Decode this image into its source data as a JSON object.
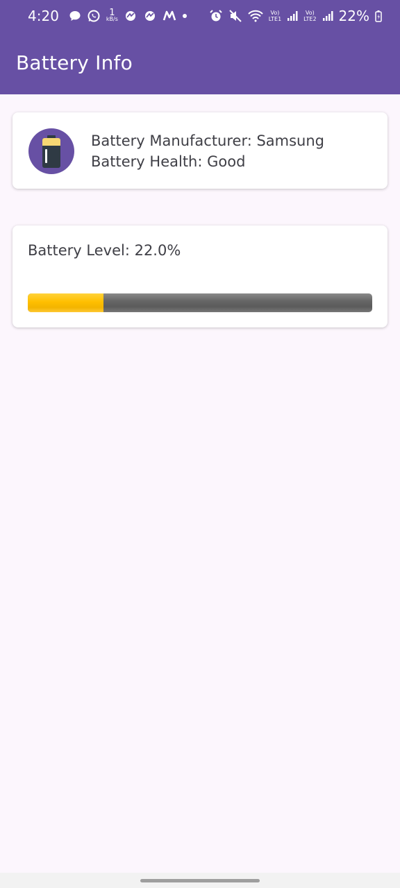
{
  "status_bar": {
    "time": "4:20",
    "net_speed_value": "1",
    "net_speed_unit": "kB/s",
    "sim1_label_top": "Vo)",
    "sim1_label_bottom": "LTE1",
    "sim2_label_top": "Vo)",
    "sim2_label_bottom": "LTE2",
    "battery_percent": "22%",
    "icons": [
      "chat-icon",
      "whatsapp-icon",
      "app-icon",
      "app-icon",
      "myntra-icon",
      "dot-icon",
      "alarm-icon",
      "mute-icon",
      "wifi-icon",
      "signal-icon",
      "signal-icon",
      "battery-charging-icon"
    ]
  },
  "app_bar": {
    "title": "Battery Info"
  },
  "info_card": {
    "manufacturer_text": "Battery Manufacturer: Samsung",
    "health_text": "Battery Health: Good",
    "icon": "battery-icon"
  },
  "level_card": {
    "level_text": "Battery Level: 22.0%",
    "level_fraction": 0.22
  },
  "colors": {
    "primary": "#6750a4",
    "background": "#fcf6fd",
    "progress_fill": "#ffbf00",
    "progress_track": "#666666"
  }
}
